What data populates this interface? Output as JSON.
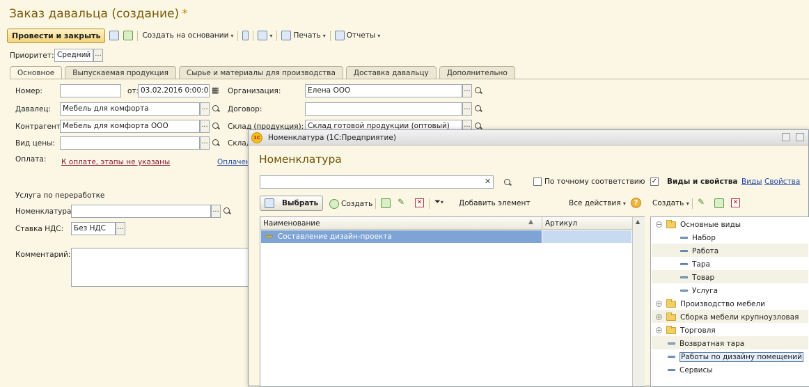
{
  "window": {
    "title": "Заказ давальца (создание)",
    "modified_mark": "*"
  },
  "toolbar": {
    "post_close": "Провести и закрыть",
    "create_based": "Создать на основании",
    "print": "Печать",
    "reports": "Отчеты"
  },
  "priority": {
    "label": "Приоритет:",
    "value": "Средний"
  },
  "tabs": [
    "Основное",
    "Выпускаемая продукция",
    "Сырье и материалы для производства",
    "Доставка давальцу",
    "Дополнительно"
  ],
  "form": {
    "number_label": "Номер:",
    "number_value": "",
    "from_label": "от:",
    "date_value": "03.02.2016  0:00:00",
    "org_label": "Организация:",
    "org_value": "Елена ООО",
    "giver_label": "Давалец:",
    "giver_value": "Мебель для комфорта",
    "contract_label": "Договор:",
    "contract_value": "",
    "counterparty_label": "Контрагент:",
    "counterparty_value": "Мебель для комфорта ООО",
    "warehouse_label": "Склад (продукция):",
    "warehouse_value": "Склад готовой продукции (оптовый)",
    "price_type_label": "Вид цены:",
    "price_type_value": "",
    "warehouse2_label": "Склад",
    "payment_label": "Оплата:",
    "payment_link": "К оплате, этапы не указаны",
    "payment_link2": "Оплачен",
    "service_label": "Услуга по переработке",
    "nomenclature_label": "Номенклатура:",
    "nomenclature_value": "",
    "vat_label": "Ставка НДС:",
    "vat_value": "Без НДС",
    "comment_label": "Комментарий:"
  },
  "dialog": {
    "title": "Номенклатура  (1С:Предприятие)",
    "heading": "Номенклатура",
    "search_value": "",
    "exact_match": "По точному соответствию",
    "kinds_props": "Виды и свойства",
    "kinds_link": "Виды",
    "props_link": "Свойства",
    "select_btn": "Выбрать",
    "create_btn": "Создать",
    "add_element": "Добавить элемент",
    "all_actions": "Все действия",
    "right_create": "Создать",
    "col_name": "Наименование",
    "col_article": "Артикул",
    "rows": [
      {
        "name": "Составление дизайн-проекта",
        "article": ""
      }
    ],
    "tree": [
      {
        "label": "Основные виды",
        "type": "folder",
        "expander": "⊖"
      },
      {
        "label": "Набор",
        "type": "item"
      },
      {
        "label": "Работа",
        "type": "item"
      },
      {
        "label": "Тара",
        "type": "item"
      },
      {
        "label": "Товар",
        "type": "item"
      },
      {
        "label": "Услуга",
        "type": "item"
      },
      {
        "label": "Производство мебели",
        "type": "folder",
        "expander": "⊕"
      },
      {
        "label": "Сборка мебели крупноузловая",
        "type": "folder",
        "expander": "⊕"
      },
      {
        "label": "Торговля",
        "type": "folder",
        "expander": "⊕"
      },
      {
        "label": "Возвратная тара",
        "type": "item"
      },
      {
        "label": "Работы по дизайну помещений",
        "type": "item"
      },
      {
        "label": "Сервисы",
        "type": "item"
      }
    ]
  },
  "colors": {
    "accent": "#7a5a08",
    "selection": "#7ea4d6",
    "link": "#2448a8"
  }
}
